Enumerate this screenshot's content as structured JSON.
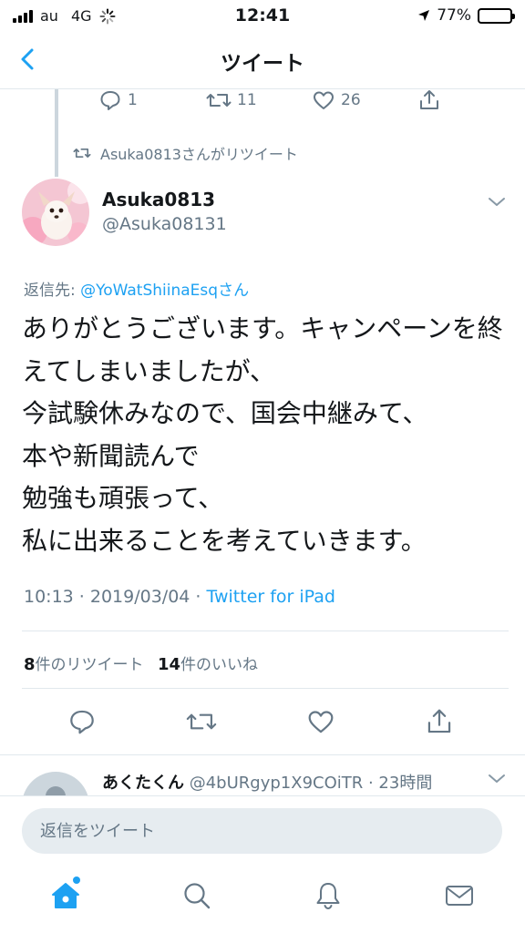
{
  "status_bar": {
    "carrier": "au",
    "network": "4G",
    "time": "12:41",
    "battery": "77%",
    "battery_level": 0.77
  },
  "nav": {
    "title": "ツイート",
    "back_icon": "chevron-left-icon"
  },
  "previous_tweet": {
    "replies": "1",
    "retweets": "11",
    "likes": "26"
  },
  "retweet_note": "Asuka0813さんがリツイート",
  "tweet": {
    "author_name": "Asuka0813",
    "author_handle": "@Asuka08131",
    "reply_prefix": "返信先: ",
    "reply_mention": "@YoWatShiinaEsqさん",
    "text": "ありがとうございます。キャンペーンを終えてしまいましたが、\n今試験休みなので、国会中継みて、\n本や新聞読んで\n勉強も頑張って、\n私に出来ることを考えていきます。",
    "timestamp": "10:13 · 2019/03/04 · ",
    "source": "Twitter for iPad",
    "retweet_count": "8",
    "retweet_label": "件のリツイート",
    "like_count": "14",
    "like_label": "件のいいね"
  },
  "next_tweet": {
    "name": "あくたくん",
    "meta": " @4bURgyp1X9COiTR · 23時間"
  },
  "reply_bar": {
    "placeholder": "返信をツイート"
  },
  "colors": {
    "accent": "#1da1f2",
    "secondary_text": "#657786",
    "divider": "#e1e8ed"
  }
}
